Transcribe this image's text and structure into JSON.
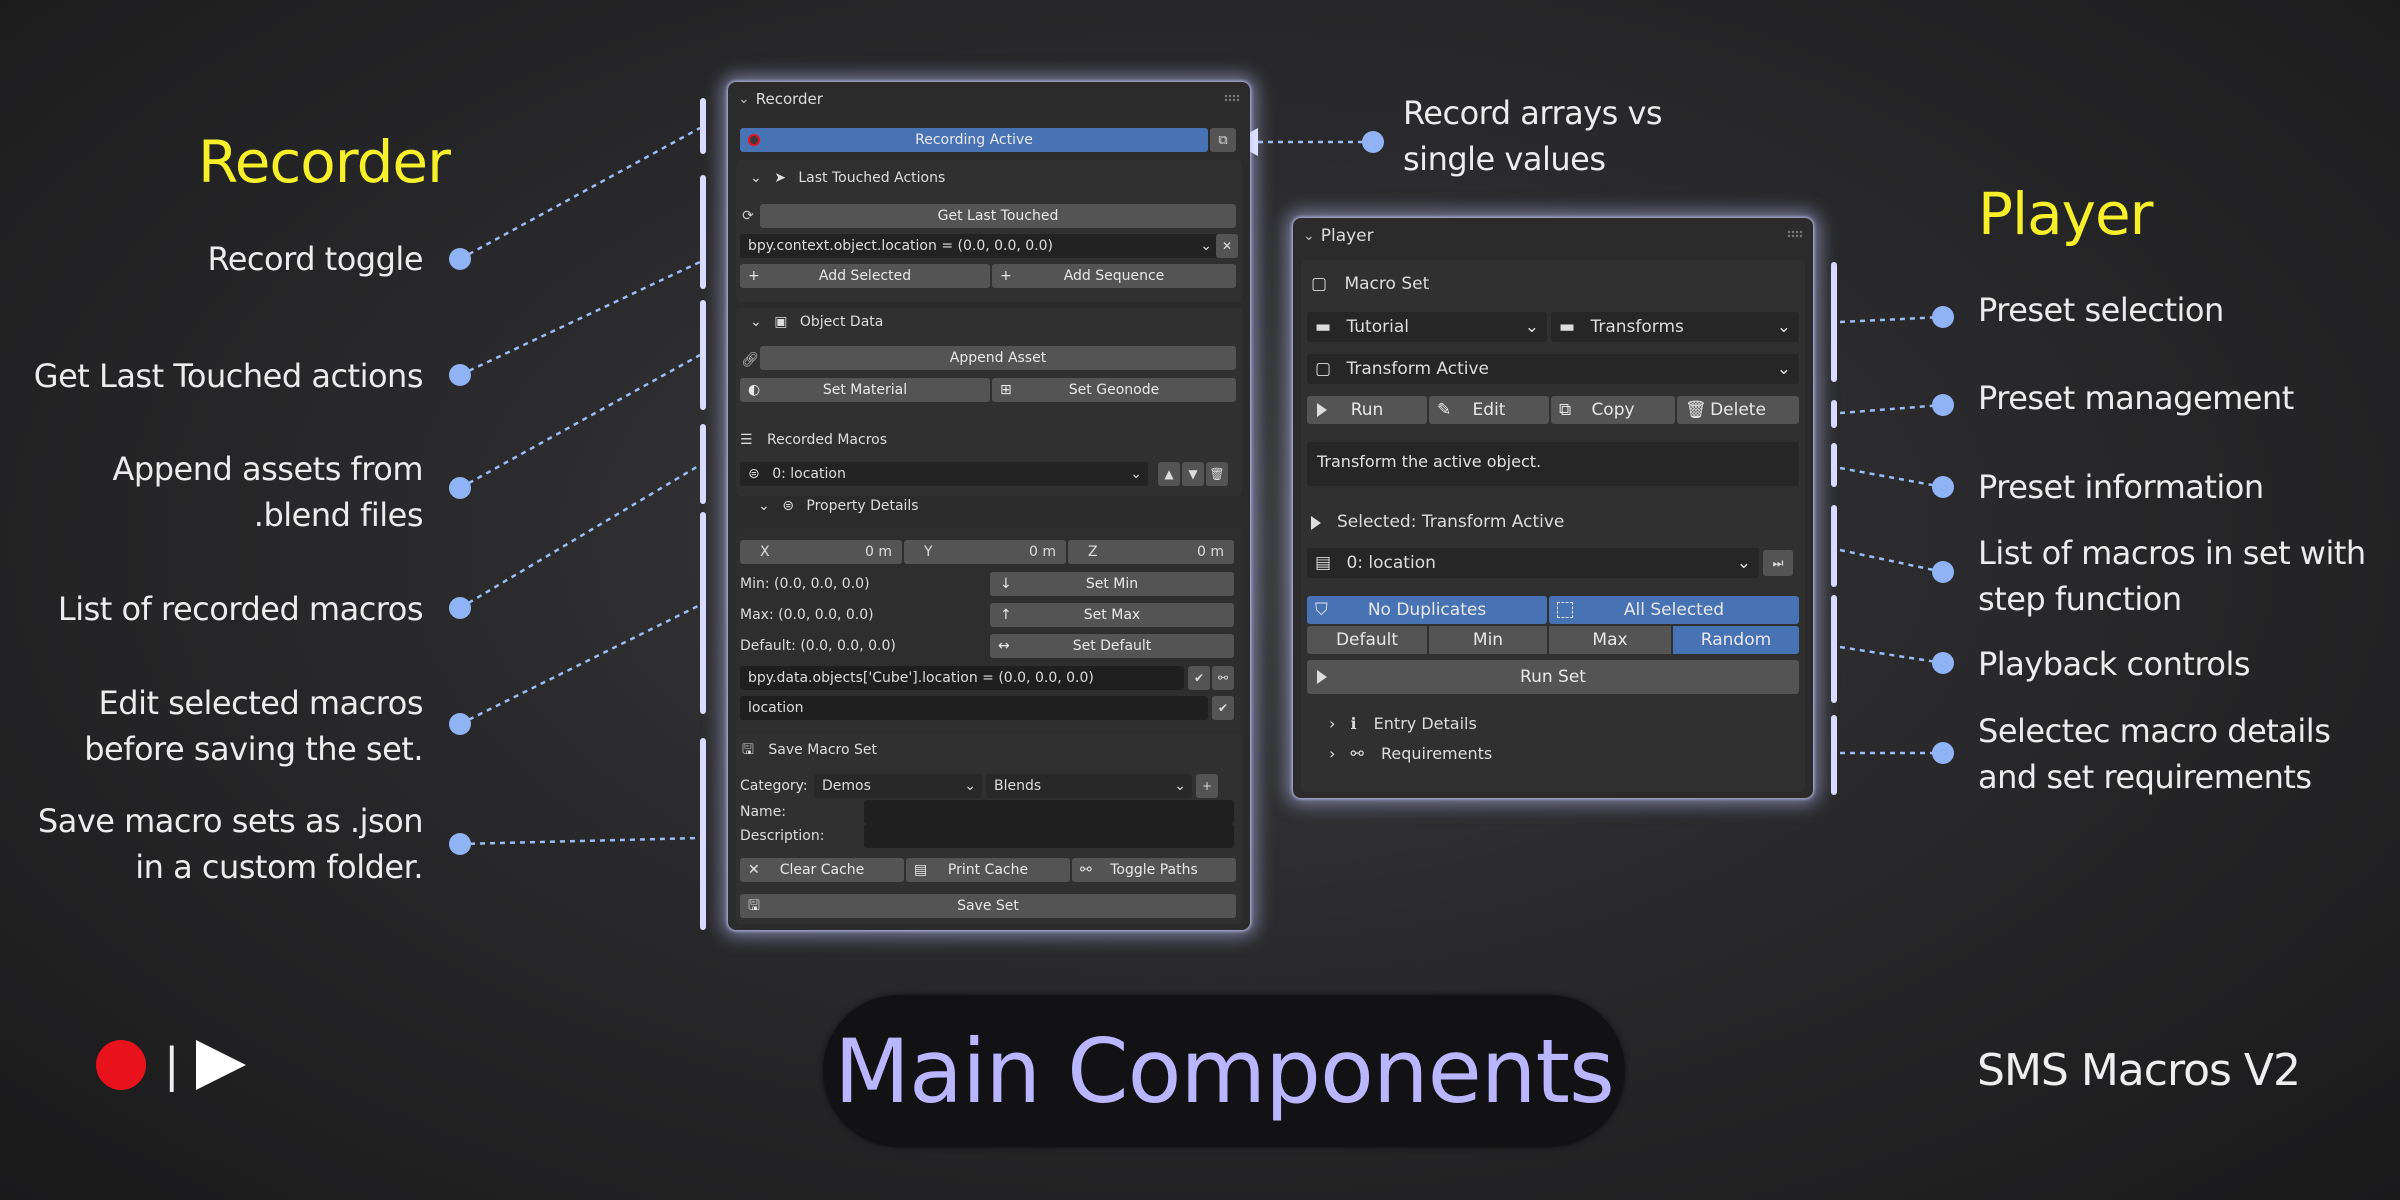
{
  "headings": {
    "recorder": "Recorder",
    "player": "Player"
  },
  "annotations_left": {
    "record_toggle": "Record toggle",
    "get_last": "Get Last Touched actions",
    "append_line1": "Append assets from",
    "append_line2": ".blend files",
    "list_recorded": "List of recorded macros",
    "edit_line1": "Edit selected macros",
    "edit_line2": "before saving the set.",
    "save_line1": "Save macro sets as .json",
    "save_line2": "in a custom folder."
  },
  "annotations_right": {
    "record_arrays_line1": "Record arrays vs",
    "record_arrays_line2": "single values",
    "preset_selection": "Preset selection",
    "preset_management": "Preset management",
    "preset_information": "Preset information",
    "list_macros_line1": "List of macros in set with",
    "list_macros_line2": "step function",
    "playback": "Playback controls",
    "selected_line1": "Selectec macro details",
    "selected_line2": "and set requirements"
  },
  "recorder": {
    "title": "Recorder",
    "recording_active": "Recording Active",
    "last_touched_actions": "Last Touched Actions",
    "get_last_touched": "Get Last Touched",
    "last_touched_value": "bpy.context.object.location = (0.0, 0.0, 0.0)",
    "add_selected": "Add Selected",
    "add_sequence": "Add Sequence",
    "object_data": "Object Data",
    "append_asset": "Append Asset",
    "set_material": "Set Material",
    "set_geonode": "Set Geonode",
    "recorded_macros": "Recorded Macros",
    "recorded_item": "0: location",
    "property_details": "Property Details",
    "x_label": "X",
    "x_value": "0 m",
    "y_label": "Y",
    "y_value": "0 m",
    "z_label": "Z",
    "z_value": "0 m",
    "min_text": "Min: (0.0, 0.0, 0.0)",
    "max_text": "Max: (0.0, 0.0, 0.0)",
    "default_text": "Default: (0.0, 0.0, 0.0)",
    "set_min": "Set Min",
    "set_max": "Set Max",
    "set_default": "Set Default",
    "data_path": "bpy.data.objects['Cube'].location = (0.0, 0.0, 0.0)",
    "name_value": "location",
    "save_macro_set": "Save Macro Set",
    "category_label": "Category:",
    "category_value": "Demos",
    "category_value2": "Blends",
    "name_label": "Name:",
    "description_label": "Description:",
    "clear_cache": "Clear Cache",
    "print_cache": "Print Cache",
    "toggle_paths": "Toggle Paths",
    "save_set": "Save Set"
  },
  "player": {
    "title": "Player",
    "macro_set": "Macro Set",
    "category": "Tutorial",
    "set": "Transforms",
    "preset": "Transform Active",
    "run": "Run",
    "edit": "Edit",
    "copy": "Copy",
    "delete": "Delete",
    "description": "Transform the active object.",
    "selected": "Selected: Transform Active",
    "macro_item": "0: location",
    "no_duplicates": "No Duplicates",
    "all_selected": "All Selected",
    "mode_default": "Default",
    "mode_min": "Min",
    "mode_max": "Max",
    "mode_random": "Random",
    "run_set": "Run Set",
    "entry_details": "Entry Details",
    "requirements": "Requirements"
  },
  "footer": {
    "title": "Main Components",
    "brand": "SMS Macros V2",
    "separator": "|"
  },
  "colors": {
    "accent_blue": "#4772b3",
    "dot_blue": "#8fb3f5",
    "heading_yellow": "#f6ef2a",
    "title_purple": "#b9b5ff",
    "record_red": "#e8121d"
  }
}
